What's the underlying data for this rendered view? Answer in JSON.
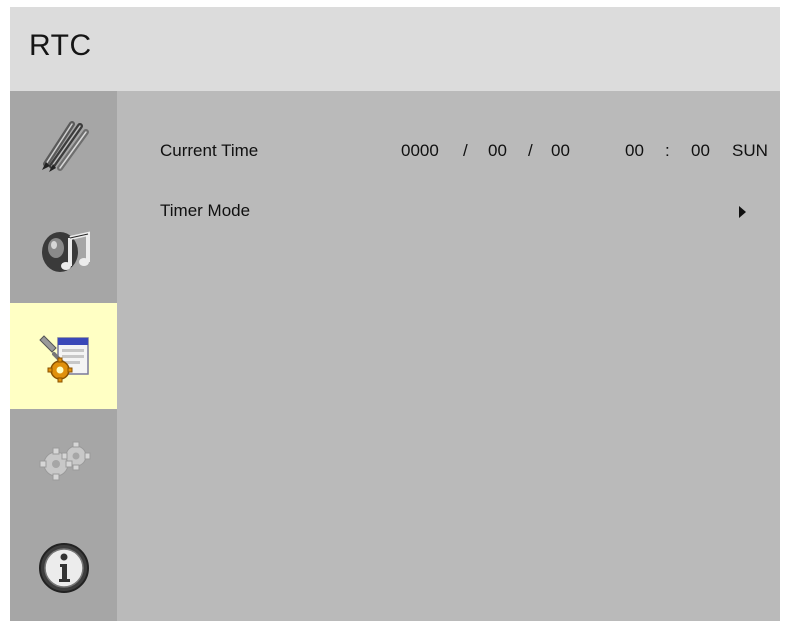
{
  "header": {
    "title": "RTC"
  },
  "sidebar": {
    "items": [
      {
        "icon": "pen-brushes-icon",
        "selected": false
      },
      {
        "icon": "audio-speaker-icon",
        "selected": false
      },
      {
        "icon": "settings-tools-icon",
        "selected": true
      },
      {
        "icon": "gears-icon",
        "selected": false
      },
      {
        "icon": "info-icon",
        "selected": false
      }
    ]
  },
  "menu": {
    "current_time": {
      "label": "Current Time",
      "year": "0000",
      "sep1": "/",
      "month": "00",
      "sep2": "/",
      "day": "00",
      "hour": "00",
      "colon": ":",
      "minute": "00",
      "weekday": "SUN"
    },
    "timer_mode": {
      "label": "Timer Mode",
      "submenu_icon": "arrow-right-icon"
    }
  },
  "colors": {
    "header_bg": "#dcdcdc",
    "content_bg": "#bababa",
    "sidebar_bg": "#a6a6a6",
    "selected_bg": "#ffffc4"
  }
}
